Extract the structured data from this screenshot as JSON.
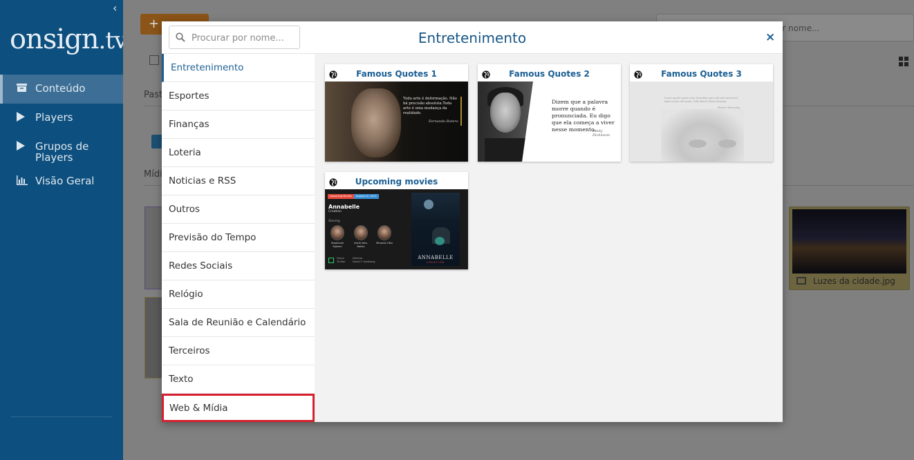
{
  "app": {
    "logo_main": "onsign",
    "logo_suffix": ".tv",
    "collapse_glyph": "‹",
    "nav": [
      {
        "label": "Conteúdo",
        "icon": "folder-icon"
      },
      {
        "label": "Players",
        "icon": "play-icon"
      },
      {
        "label": "Grupos de Players",
        "icon": "play-icon"
      },
      {
        "label": "Visão Geral",
        "icon": "bar-chart-icon"
      }
    ],
    "background": {
      "add_button_label": "+",
      "search_placeholder": "or nome...",
      "text_pasta": "Past",
      "text_midia": "Mídi",
      "right_card_caption": "Luzes da cidade.jpg"
    }
  },
  "modal": {
    "search_placeholder": "Procurar por nome...",
    "title": "Entretenimento",
    "close_label": "×",
    "categories": [
      "Entretenimento",
      "Esportes",
      "Finanças",
      "Loteria",
      "Noticias e RSS",
      "Outros",
      "Previsão do Tempo",
      "Redes Sociais",
      "Relógio",
      "Sala de Reunião e Calendário",
      "Terceiros",
      "Texto",
      "Web & Mídia"
    ],
    "active_category_index": 0,
    "highlighted_category_index": 12,
    "cards": [
      {
        "title": "Famous Quotes 1",
        "quote": "Toda arte é deformação. Não há precisão absoluta.Toda arte é uma mudança da realidade.",
        "author": "Fernando Botero"
      },
      {
        "title": "Famous Quotes 2",
        "quote": "Dizem que a palavra morre quando é pronunciada. Eu digo que ela começa a viver nesse momento.",
        "author": "Emily Dickinson"
      },
      {
        "title": "Famous Quotes 3",
        "quote": "Leave quotes quote your describes quo sub sula ancestral, axax in arte ob-scoria. Tella Boult Causa desarqu.",
        "author": "Robert Bresslay"
      },
      {
        "title": "Upcoming movies",
        "banner_label": "Upcoming Movies",
        "banner_date": "August 11, 2017",
        "movie_title": "Annabelle",
        "movie_subtitle": "Creation",
        "starring_label": "Starring",
        "actors": [
          "Stephanie Sigman",
          "Alicia Vela-Bailey",
          "Miranda Otto"
        ],
        "genre_label": "Genre",
        "genre_value": "Thriller",
        "director_label": "Director",
        "director_value": "David F. Sandberg",
        "poster_title": "ANNABELLE",
        "poster_subtitle": "CREATION"
      }
    ]
  }
}
